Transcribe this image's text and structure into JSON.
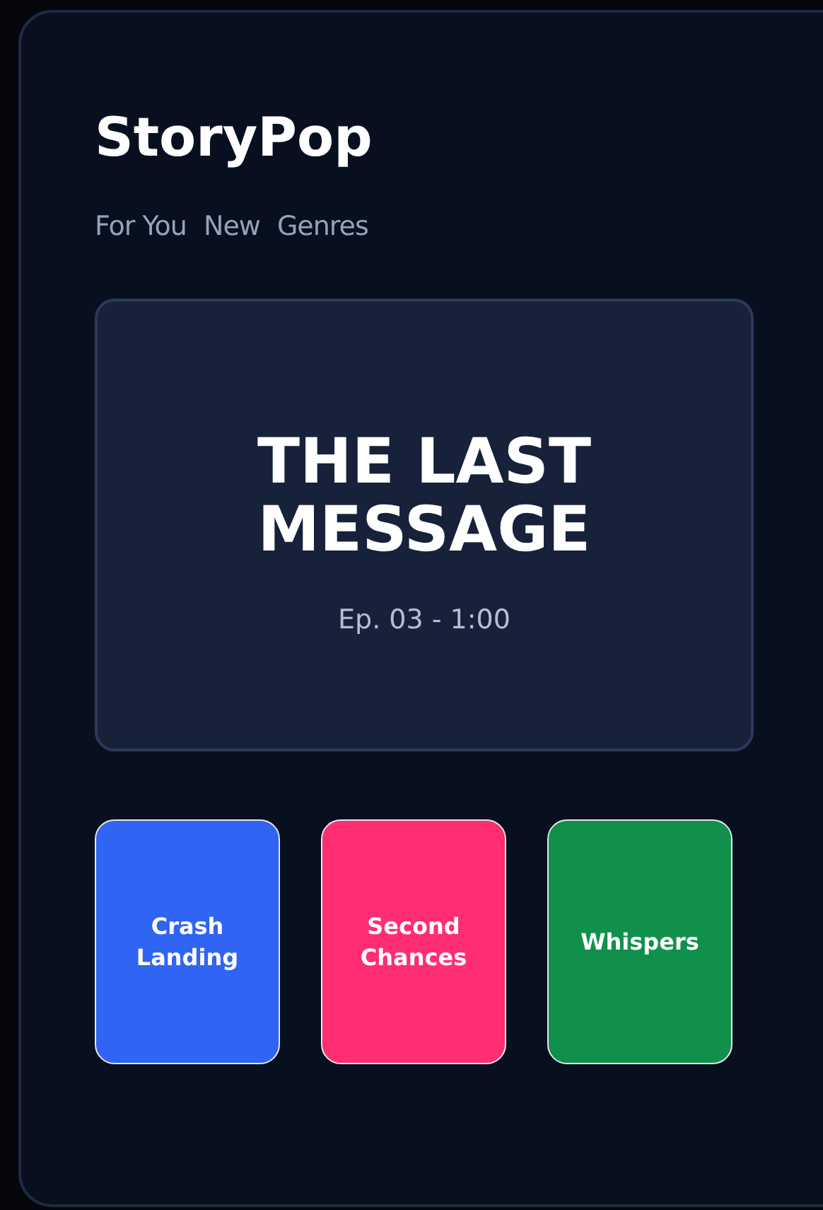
{
  "app": {
    "title": "StoryPop"
  },
  "nav": [
    {
      "label": "For You"
    },
    {
      "label": "New"
    },
    {
      "label": "Genres"
    }
  ],
  "featured": {
    "title": "THE LAST MESSAGE",
    "episode": "Ep. 03 - 1:00"
  },
  "stories": [
    {
      "title": "Crash Landing",
      "color": "#3064f2"
    },
    {
      "title": "Second Chances",
      "color": "#ff2d71"
    },
    {
      "title": "Whispers",
      "color": "#11904c"
    }
  ]
}
